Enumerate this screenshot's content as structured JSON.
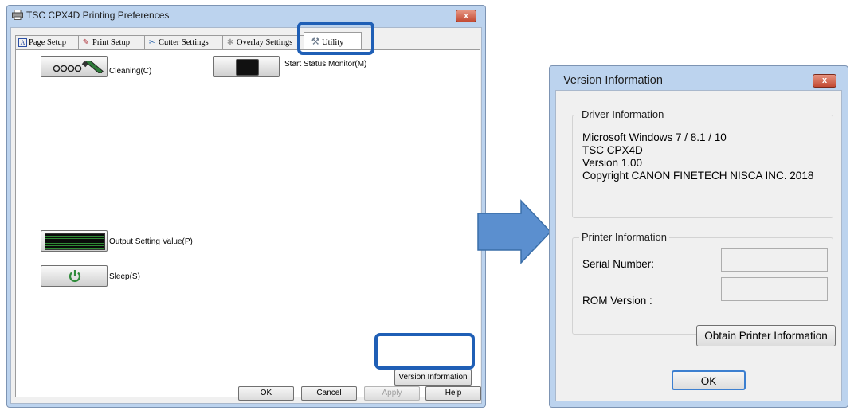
{
  "printing_preferences": {
    "title": "TSC CPX4D Printing Preferences",
    "close_glyph": "x",
    "tabs": [
      {
        "label": "Page Setup",
        "icon": "page-setup-icon"
      },
      {
        "label": "Print Setup",
        "icon": "print-setup-icon"
      },
      {
        "label": "Cutter Settings",
        "icon": "cutter-icon"
      },
      {
        "label": "Overlay Settings",
        "icon": "overlay-icon"
      },
      {
        "label": "Utility",
        "icon": "tools-icon"
      }
    ],
    "utility": {
      "cleaning_label": "Cleaning(C)",
      "status_monitor_label": "Start Status Monitor(M)",
      "output_setting_label": "Output Setting Value(P)",
      "sleep_label": "Sleep(S)",
      "version_info_button": "Version Information"
    },
    "footer": {
      "ok": "OK",
      "cancel": "Cancel",
      "apply": "Apply",
      "help": "Help"
    }
  },
  "version_information": {
    "title": "Version Information",
    "close_glyph": "x",
    "driver_group_label": "Driver Information",
    "driver_lines": [
      "Microsoft Windows 7 / 8.1 / 10",
      "TSC CPX4D",
      "Version 1.00",
      "Copyright CANON FINETECH NISCA INC. 2018"
    ],
    "printer_group_label": "Printer Information",
    "serial_label": "Serial Number:",
    "serial_value": "",
    "rom_label": "ROM Version :",
    "rom_value": "",
    "obtain_button": "Obtain Printer Information",
    "ok_button": "OK"
  },
  "colors": {
    "highlight": "#1f5fb6",
    "arrow": "#5b8fcf",
    "window_frame": "#bcd3ee"
  }
}
